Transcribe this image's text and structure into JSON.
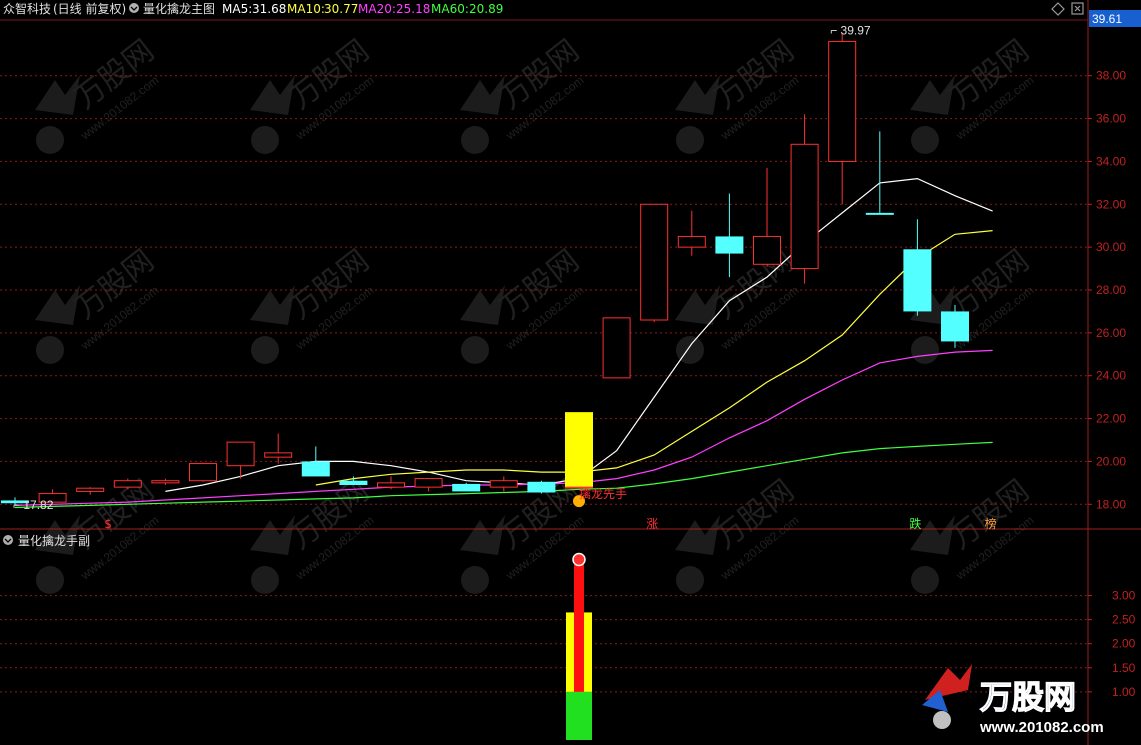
{
  "header": {
    "stock": "众智科技",
    "period": "(日线 前复权)",
    "indicator": "量化擒龙主图",
    "ma": [
      {
        "label": "MA5:",
        "value": "31.68",
        "color": "#ffffff"
      },
      {
        "label": "MA10:",
        "value": "30.77",
        "color": "#ffff40"
      },
      {
        "label": "MA20:",
        "value": "25.18",
        "color": "#ff40ff"
      },
      {
        "label": "MA60:",
        "value": "20.89",
        "color": "#40ff40"
      }
    ]
  },
  "sub_header": {
    "indicator": "量化擒龙手副"
  },
  "current_price": "39.61",
  "watermark": {
    "brand": "万股网",
    "url": "www.201082.com"
  },
  "chart_data": [
    {
      "type": "candlestick",
      "title": "量化擒龙主图",
      "ylim": [
        17.5,
        40.6
      ],
      "y_ticks": [
        "18.00",
        "20.00",
        "22.00",
        "24.00",
        "26.00",
        "28.00",
        "30.00",
        "32.00",
        "34.00",
        "36.00",
        "38.00"
      ],
      "candles": [
        {
          "o": 18.18,
          "h": 18.32,
          "l": 17.95,
          "c": 18.05,
          "up": false
        },
        {
          "o": 18.1,
          "h": 18.7,
          "l": 18.05,
          "c": 18.5,
          "up": true
        },
        {
          "o": 18.6,
          "h": 18.8,
          "l": 18.45,
          "c": 18.75,
          "up": true
        },
        {
          "o": 18.8,
          "h": 19.2,
          "l": 18.7,
          "c": 19.1,
          "up": true
        },
        {
          "o": 19.0,
          "h": 19.2,
          "l": 18.9,
          "c": 19.1,
          "up": true
        },
        {
          "o": 19.1,
          "h": 19.95,
          "l": 19.05,
          "c": 19.9,
          "up": true
        },
        {
          "o": 19.8,
          "h": 20.9,
          "l": 19.2,
          "c": 20.9,
          "up": true
        },
        {
          "o": 20.2,
          "h": 21.3,
          "l": 19.9,
          "c": 20.4,
          "up": true
        },
        {
          "o": 20.0,
          "h": 20.7,
          "l": 19.3,
          "c": 19.3,
          "up": false
        },
        {
          "o": 19.1,
          "h": 19.3,
          "l": 18.9,
          "c": 18.9,
          "up": false
        },
        {
          "o": 18.8,
          "h": 19.3,
          "l": 18.7,
          "c": 19.0,
          "up": true
        },
        {
          "o": 18.8,
          "h": 19.2,
          "l": 18.6,
          "c": 19.2,
          "up": true
        },
        {
          "o": 18.95,
          "h": 19.0,
          "l": 18.6,
          "c": 18.6,
          "up": false
        },
        {
          "o": 18.8,
          "h": 19.3,
          "l": 18.6,
          "c": 19.1,
          "up": true
        },
        {
          "o": 19.05,
          "h": 19.1,
          "l": 18.5,
          "c": 18.55,
          "up": false
        },
        {
          "o": 18.8,
          "h": 18.8,
          "l": 18.8,
          "c": 18.8,
          "up": true
        },
        {
          "o": 23.9,
          "h": 26.7,
          "l": 23.9,
          "c": 26.7,
          "up": true
        },
        {
          "o": 26.6,
          "h": 32.0,
          "l": 26.5,
          "c": 32.0,
          "up": true
        },
        {
          "o": 30.0,
          "h": 31.7,
          "l": 29.6,
          "c": 30.5,
          "up": true
        },
        {
          "o": 30.5,
          "h": 32.5,
          "l": 28.6,
          "c": 29.7,
          "up": false
        },
        {
          "o": 29.2,
          "h": 33.7,
          "l": 29.1,
          "c": 30.5,
          "up": true
        },
        {
          "o": 29.0,
          "h": 36.2,
          "l": 28.3,
          "c": 34.8,
          "up": true
        },
        {
          "o": 34.0,
          "h": 39.97,
          "l": 32.0,
          "c": 39.6,
          "up": true
        },
        {
          "o": 31.6,
          "h": 35.4,
          "l": 31.6,
          "c": 31.6,
          "up": false
        },
        {
          "o": 29.9,
          "h": 31.3,
          "l": 26.8,
          "c": 27.0,
          "up": false
        },
        {
          "o": 27.0,
          "h": 27.3,
          "l": 25.3,
          "c": 25.6,
          "up": false
        }
      ],
      "signal_bar": {
        "index": 15,
        "low": 18.8,
        "high": 22.3
      },
      "series": [
        {
          "name": "MA5",
          "color": "#ffffff",
          "values": [
            null,
            null,
            null,
            null,
            18.6,
            18.9,
            19.3,
            19.8,
            20.0,
            20.0,
            19.8,
            19.5,
            19.1,
            19.0,
            18.9,
            19.2,
            20.5,
            23.0,
            25.5,
            27.5,
            28.6,
            30.2,
            31.6,
            33.0,
            33.2,
            32.4,
            31.68
          ]
        },
        {
          "name": "MA10",
          "color": "#ffff40",
          "values": [
            null,
            null,
            null,
            null,
            null,
            null,
            null,
            null,
            18.9,
            19.2,
            19.4,
            19.5,
            19.6,
            19.6,
            19.5,
            19.5,
            19.7,
            20.3,
            21.4,
            22.5,
            23.7,
            24.7,
            25.9,
            27.8,
            29.5,
            30.6,
            30.77
          ]
        },
        {
          "name": "MA20",
          "color": "#ff40ff",
          "values": [
            17.95,
            18.0,
            18.05,
            18.1,
            18.2,
            18.3,
            18.4,
            18.5,
            18.6,
            18.7,
            18.8,
            18.85,
            18.9,
            18.9,
            18.95,
            19.0,
            19.2,
            19.6,
            20.2,
            21.1,
            21.9,
            22.9,
            23.8,
            24.6,
            24.9,
            25.1,
            25.18
          ]
        },
        {
          "name": "MA60",
          "color": "#40ff40",
          "values": [
            17.85,
            17.9,
            17.95,
            18.0,
            18.05,
            18.1,
            18.15,
            18.2,
            18.25,
            18.3,
            18.4,
            18.45,
            18.5,
            18.55,
            18.6,
            18.7,
            18.75,
            18.95,
            19.2,
            19.5,
            19.8,
            20.1,
            20.4,
            20.6,
            20.7,
            20.8,
            20.89
          ]
        }
      ],
      "annotations": {
        "high_label": "39.97",
        "low_label": "17.82",
        "signal_label": "擒龙先手",
        "markers": [
          {
            "index": 2,
            "text": "$"
          },
          {
            "index": 17,
            "text": "涨"
          },
          {
            "index": 24,
            "text": "跌"
          },
          {
            "index": 26,
            "text": "榜"
          }
        ]
      }
    },
    {
      "type": "bar",
      "title": "量化擒龙手副",
      "ylim": [
        0.0,
        4.3
      ],
      "y_ticks": [
        "1.00",
        "1.50",
        "2.00",
        "2.50",
        "3.00"
      ],
      "index": 15,
      "stack": [
        {
          "from": 0.0,
          "to": 1.0,
          "color": "#20e020"
        },
        {
          "from": 1.0,
          "to": 2.65,
          "color": "#ffff00"
        },
        {
          "from": 1.0,
          "to": 3.75,
          "color": "#ff1010",
          "narrow": true
        }
      ],
      "cap": 3.75
    }
  ]
}
